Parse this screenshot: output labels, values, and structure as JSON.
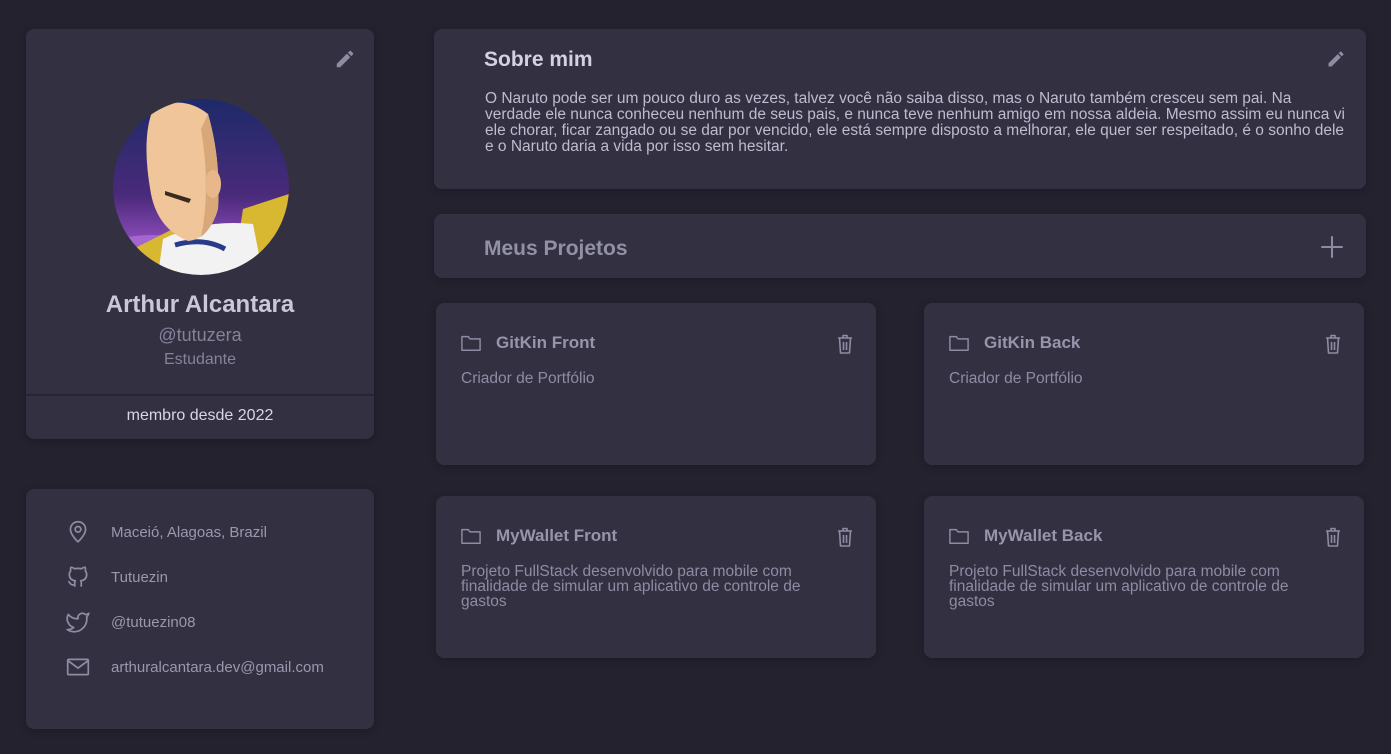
{
  "profile": {
    "name": "Arthur Alcantara",
    "handle": "@tutuzera",
    "role": "Estudante",
    "member_since": "membro desde 2022"
  },
  "contacts": [
    {
      "icon": "location-pin-icon",
      "label": "Maceió, Alagoas, Brazil"
    },
    {
      "icon": "github-icon",
      "label": "Tutuezin"
    },
    {
      "icon": "twitter-icon",
      "label": "@tutuezin08"
    },
    {
      "icon": "mail-icon",
      "label": "arthuralcantara.dev@gmail.com"
    }
  ],
  "about": {
    "title": "Sobre mim",
    "text": "O Naruto pode ser um pouco duro as vezes, talvez você não saiba disso, mas o Naruto também cresceu sem pai. Na verdade ele nunca conheceu nenhum de seus pais, e nunca teve nenhum amigo em nossa aldeia. Mesmo assim eu nunca vi ele chorar, ficar zangado ou se dar por vencido, ele está sempre disposto a melhorar, ele quer ser respeitado, é o sonho dele e o Naruto daria a vida por isso sem hesitar."
  },
  "projects": {
    "title": "Meus Projetos",
    "items": [
      {
        "title": "GitKin Front",
        "description": "Criador de Portfólio"
      },
      {
        "title": "GitKin Back",
        "description": "Criador de Portfólio"
      },
      {
        "title": "MyWallet Front",
        "description": "Projeto FullStack desenvolvido para mobile com finalidade de simular um aplicativo de controle de gastos"
      },
      {
        "title": "MyWallet Back",
        "description": "Projeto FullStack desenvolvido para mobile com finalidade de simular um aplicativo de controle de gastos"
      }
    ]
  },
  "colors": {
    "background": "#24222f",
    "card": "#323041",
    "icon": "#8e8ca3"
  }
}
